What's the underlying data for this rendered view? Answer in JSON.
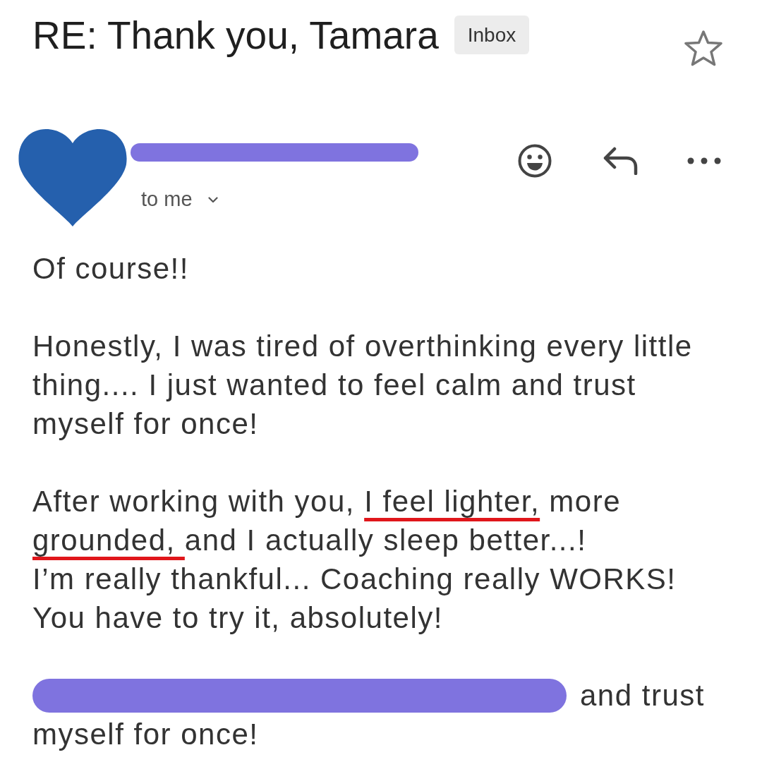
{
  "subject": {
    "title": "RE: Thank you, Tamara",
    "label": "Inbox",
    "starred": false
  },
  "sender": {
    "recipient_toggle": "to me"
  },
  "body": [
    {
      "lines": [
        [
          {
            "kind": "text",
            "text": "Of course!!",
            "underlined": false
          }
        ]
      ]
    },
    {
      "lines": [
        [
          {
            "kind": "text",
            "text": "Honestly, I was tired of overthinking every little",
            "underlined": false
          }
        ],
        [
          {
            "kind": "text",
            "text": "thing.... I just wanted to feel calm and trust",
            "underlined": false
          }
        ],
        [
          {
            "kind": "text",
            "text": "myself for once!",
            "underlined": false
          }
        ]
      ]
    },
    {
      "lines": [
        [
          {
            "kind": "text",
            "text": "After working with you, ",
            "underlined": false
          },
          {
            "kind": "text",
            "text": "I feel lighter,",
            "underlined": true
          },
          {
            "kind": "text",
            "text": " more",
            "underlined": false
          }
        ],
        [
          {
            "kind": "text",
            "text": "grounded, ",
            "underlined": true
          },
          {
            "kind": "text",
            "text": "and I actually sleep better...!",
            "underlined": false
          }
        ],
        [
          {
            "kind": "text",
            "text": "I’m really thankful... Coaching really WORKS!",
            "underlined": false
          }
        ],
        [
          {
            "kind": "text",
            "text": "You have to try it, absolutely!",
            "underlined": false
          }
        ]
      ]
    },
    {
      "lines": [
        [
          {
            "kind": "redaction"
          },
          {
            "kind": "text",
            "text": "and trust",
            "underlined": false
          }
        ],
        [
          {
            "kind": "text",
            "text": "myself for once!",
            "underlined": false
          }
        ]
      ]
    }
  ]
}
